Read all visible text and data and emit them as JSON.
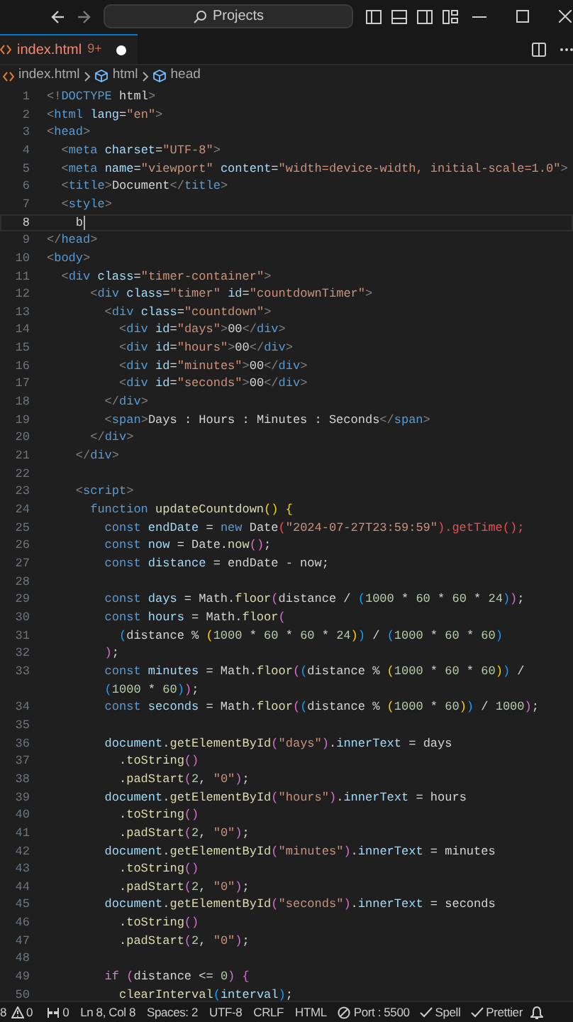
{
  "titlebar": {
    "search": "Projects"
  },
  "tabs": [
    {
      "label": "index.html",
      "badge": "9+",
      "modified": true,
      "selected": true
    }
  ],
  "breadcrumbs": [
    {
      "kind": "file",
      "label": "index.html"
    },
    {
      "kind": "element",
      "label": "html"
    },
    {
      "kind": "element",
      "label": "head"
    }
  ],
  "lines": [
    {
      "n": "1",
      "active": false,
      "tokens": [
        {
          "kind": "p",
          "text": "<!"
        },
        {
          "kind": "tag",
          "text": "DOCTYPE"
        },
        {
          "kind": "t",
          "text": " html"
        },
        {
          "kind": "p",
          "text": ">"
        }
      ]
    },
    {
      "n": "2",
      "active": false,
      "tokens": [
        {
          "kind": "p",
          "text": "<"
        },
        {
          "kind": "tag",
          "text": "html"
        },
        {
          "kind": "at",
          "text": " lang"
        },
        {
          "kind": "t",
          "text": "="
        },
        {
          "kind": "s",
          "text": "\"en\""
        },
        {
          "kind": "p",
          "text": ">"
        }
      ]
    },
    {
      "n": "3",
      "active": false,
      "tokens": [
        {
          "kind": "p",
          "text": "<"
        },
        {
          "kind": "tag",
          "text": "head"
        },
        {
          "kind": "p",
          "text": ">"
        }
      ]
    },
    {
      "n": "4",
      "active": false,
      "tokens": [
        {
          "kind": "p",
          "text": "  <"
        },
        {
          "kind": "tag",
          "text": "meta"
        },
        {
          "kind": "at",
          "text": " charset"
        },
        {
          "kind": "t",
          "text": "="
        },
        {
          "kind": "s",
          "text": "\"UTF-8\""
        },
        {
          "kind": "p",
          "text": ">"
        }
      ]
    },
    {
      "n": "5",
      "active": false,
      "tokens": [
        {
          "kind": "p",
          "text": "  <"
        },
        {
          "kind": "tag",
          "text": "meta"
        },
        {
          "kind": "at",
          "text": " name"
        },
        {
          "kind": "t",
          "text": "="
        },
        {
          "kind": "s",
          "text": "\"viewport\""
        },
        {
          "kind": "at",
          "text": " content"
        },
        {
          "kind": "t",
          "text": "="
        },
        {
          "kind": "s",
          "text": "\"width=device-width, initial-scale=1.0\""
        },
        {
          "kind": "p",
          "text": ">"
        }
      ]
    },
    {
      "n": "6",
      "active": false,
      "tokens": [
        {
          "kind": "p",
          "text": "  <"
        },
        {
          "kind": "tag",
          "text": "title"
        },
        {
          "kind": "p",
          "text": ">"
        },
        {
          "kind": "t",
          "text": "Document"
        },
        {
          "kind": "p",
          "text": "</"
        },
        {
          "kind": "tag",
          "text": "title"
        },
        {
          "kind": "p",
          "text": ">"
        }
      ]
    },
    {
      "n": "7",
      "active": false,
      "tokens": [
        {
          "kind": "p",
          "text": "  <"
        },
        {
          "kind": "tag",
          "text": "style"
        },
        {
          "kind": "p",
          "text": ">"
        }
      ]
    },
    {
      "n": "8",
      "active": true,
      "tokens": [
        {
          "kind": "t",
          "text": "    b"
        }
      ]
    },
    {
      "n": "9",
      "active": false,
      "tokens": [
        {
          "kind": "p",
          "text": "</"
        },
        {
          "kind": "tag",
          "text": "head"
        },
        {
          "kind": "p",
          "text": ">"
        }
      ]
    },
    {
      "n": "10",
      "active": false,
      "tokens": [
        {
          "kind": "p",
          "text": "<"
        },
        {
          "kind": "tag",
          "text": "body"
        },
        {
          "kind": "p",
          "text": ">"
        }
      ]
    },
    {
      "n": "11",
      "active": false,
      "tokens": [
        {
          "kind": "p",
          "text": "  <"
        },
        {
          "kind": "tag",
          "text": "div"
        },
        {
          "kind": "at",
          "text": " class"
        },
        {
          "kind": "t",
          "text": "="
        },
        {
          "kind": "s",
          "text": "\"timer-container\""
        },
        {
          "kind": "p",
          "text": ">"
        }
      ]
    },
    {
      "n": "12",
      "active": false,
      "tokens": [
        {
          "kind": "p",
          "text": "      <"
        },
        {
          "kind": "tag",
          "text": "div"
        },
        {
          "kind": "at",
          "text": " class"
        },
        {
          "kind": "t",
          "text": "="
        },
        {
          "kind": "s",
          "text": "\"timer\""
        },
        {
          "kind": "at",
          "text": " id"
        },
        {
          "kind": "t",
          "text": "="
        },
        {
          "kind": "s",
          "text": "\"countdownTimer\""
        },
        {
          "kind": "p",
          "text": ">"
        }
      ]
    },
    {
      "n": "13",
      "active": false,
      "tokens": [
        {
          "kind": "p",
          "text": "        <"
        },
        {
          "kind": "tag",
          "text": "div"
        },
        {
          "kind": "at",
          "text": " class"
        },
        {
          "kind": "t",
          "text": "="
        },
        {
          "kind": "s",
          "text": "\"countdown\""
        },
        {
          "kind": "p",
          "text": ">"
        }
      ]
    },
    {
      "n": "14",
      "active": false,
      "tokens": [
        {
          "kind": "p",
          "text": "          <"
        },
        {
          "kind": "tag",
          "text": "div"
        },
        {
          "kind": "at",
          "text": " id"
        },
        {
          "kind": "t",
          "text": "="
        },
        {
          "kind": "s",
          "text": "\"days\""
        },
        {
          "kind": "p",
          "text": ">"
        },
        {
          "kind": "t",
          "text": "00"
        },
        {
          "kind": "p",
          "text": "</"
        },
        {
          "kind": "tag",
          "text": "div"
        },
        {
          "kind": "p",
          "text": ">"
        }
      ]
    },
    {
      "n": "15",
      "active": false,
      "tokens": [
        {
          "kind": "p",
          "text": "          <"
        },
        {
          "kind": "tag",
          "text": "div"
        },
        {
          "kind": "at",
          "text": " id"
        },
        {
          "kind": "t",
          "text": "="
        },
        {
          "kind": "s",
          "text": "\"hours\""
        },
        {
          "kind": "p",
          "text": ">"
        },
        {
          "kind": "t",
          "text": "00"
        },
        {
          "kind": "p",
          "text": "</"
        },
        {
          "kind": "tag",
          "text": "div"
        },
        {
          "kind": "p",
          "text": ">"
        }
      ]
    },
    {
      "n": "16",
      "active": false,
      "tokens": [
        {
          "kind": "p",
          "text": "          <"
        },
        {
          "kind": "tag",
          "text": "div"
        },
        {
          "kind": "at",
          "text": " id"
        },
        {
          "kind": "t",
          "text": "="
        },
        {
          "kind": "s",
          "text": "\"minutes\""
        },
        {
          "kind": "p",
          "text": ">"
        },
        {
          "kind": "t",
          "text": "00"
        },
        {
          "kind": "p",
          "text": "</"
        },
        {
          "kind": "tag",
          "text": "div"
        },
        {
          "kind": "p",
          "text": ">"
        }
      ]
    },
    {
      "n": "17",
      "active": false,
      "tokens": [
        {
          "kind": "p",
          "text": "          <"
        },
        {
          "kind": "tag",
          "text": "div"
        },
        {
          "kind": "at",
          "text": " id"
        },
        {
          "kind": "t",
          "text": "="
        },
        {
          "kind": "s",
          "text": "\"seconds\""
        },
        {
          "kind": "p",
          "text": ">"
        },
        {
          "kind": "t",
          "text": "00"
        },
        {
          "kind": "p",
          "text": "</"
        },
        {
          "kind": "tag",
          "text": "div"
        },
        {
          "kind": "p",
          "text": ">"
        }
      ]
    },
    {
      "n": "18",
      "active": false,
      "tokens": [
        {
          "kind": "p",
          "text": "        </"
        },
        {
          "kind": "tag",
          "text": "div"
        },
        {
          "kind": "p",
          "text": ">"
        }
      ]
    },
    {
      "n": "19",
      "active": false,
      "tokens": [
        {
          "kind": "p",
          "text": "        <"
        },
        {
          "kind": "tag",
          "text": "span"
        },
        {
          "kind": "p",
          "text": ">"
        },
        {
          "kind": "t",
          "text": "Days : Hours : Minutes : Seconds"
        },
        {
          "kind": "p",
          "text": "</"
        },
        {
          "kind": "tag",
          "text": "span"
        },
        {
          "kind": "p",
          "text": ">"
        }
      ]
    },
    {
      "n": "20",
      "active": false,
      "tokens": [
        {
          "kind": "p",
          "text": "      </"
        },
        {
          "kind": "tag",
          "text": "div"
        },
        {
          "kind": "p",
          "text": ">"
        }
      ]
    },
    {
      "n": "21",
      "active": false,
      "tokens": [
        {
          "kind": "p",
          "text": "    </"
        },
        {
          "kind": "tag",
          "text": "div"
        },
        {
          "kind": "p",
          "text": ">"
        }
      ]
    },
    {
      "n": "22",
      "active": false
    },
    {
      "n": "23",
      "active": false,
      "tokens": [
        {
          "kind": "p",
          "text": "    <"
        },
        {
          "kind": "tag",
          "text": "script"
        },
        {
          "kind": "p",
          "text": ">"
        }
      ]
    },
    {
      "n": "24",
      "active": false,
      "tokens": [
        {
          "kind": "kw",
          "text": "      function"
        },
        {
          "kind": "fn",
          "text": " updateCountdown"
        },
        {
          "kind": "b1",
          "text": "()"
        },
        {
          "kind": "b1",
          "text": " {"
        }
      ]
    },
    {
      "n": "25",
      "active": false,
      "tokens": [
        {
          "kind": "kw",
          "text": "        const"
        },
        {
          "kind": "v",
          "text": " endDate"
        },
        {
          "kind": "t",
          "text": " = "
        },
        {
          "kind": "kw",
          "text": "new"
        },
        {
          "kind": "t",
          "text": " Date"
        },
        {
          "kind": "e",
          "text": "("
        },
        {
          "kind": "s",
          "text": "\"2024-07-27T23:59:59\""
        },
        {
          "kind": "e",
          "text": ").getTime();"
        }
      ]
    },
    {
      "n": "26",
      "active": false,
      "tokens": [
        {
          "kind": "kw",
          "text": "        const"
        },
        {
          "kind": "v",
          "text": " now"
        },
        {
          "kind": "t",
          "text": " = Date."
        },
        {
          "kind": "fn",
          "text": "now"
        },
        {
          "kind": "b2",
          "text": "()"
        },
        {
          "kind": "t",
          "text": ";"
        }
      ]
    },
    {
      "n": "27",
      "active": false,
      "tokens": [
        {
          "kind": "kw",
          "text": "        const"
        },
        {
          "kind": "v",
          "text": " distance"
        },
        {
          "kind": "t",
          "text": " = endDate - now;"
        }
      ]
    },
    {
      "n": "28",
      "active": false
    },
    {
      "n": "29",
      "active": false,
      "tokens": [
        {
          "kind": "kw",
          "text": "        const"
        },
        {
          "kind": "v",
          "text": " days"
        },
        {
          "kind": "t",
          "text": " = Math."
        },
        {
          "kind": "fn",
          "text": "floor"
        },
        {
          "kind": "b2",
          "text": "("
        },
        {
          "kind": "t",
          "text": "distance / "
        },
        {
          "kind": "b3",
          "text": "("
        },
        {
          "kind": "n",
          "text": "1000"
        },
        {
          "kind": "t",
          "text": " * "
        },
        {
          "kind": "n",
          "text": "60"
        },
        {
          "kind": "t",
          "text": " * "
        },
        {
          "kind": "n",
          "text": "60"
        },
        {
          "kind": "t",
          "text": " * "
        },
        {
          "kind": "n",
          "text": "24"
        },
        {
          "kind": "b3",
          "text": ")"
        },
        {
          "kind": "b2",
          "text": ")"
        },
        {
          "kind": "t",
          "text": ";"
        }
      ]
    },
    {
      "n": "30",
      "active": false,
      "tokens": [
        {
          "kind": "kw",
          "text": "        const"
        },
        {
          "kind": "v",
          "text": " hours"
        },
        {
          "kind": "t",
          "text": " = Math."
        },
        {
          "kind": "fn",
          "text": "floor"
        },
        {
          "kind": "b2",
          "text": "("
        }
      ]
    },
    {
      "n": "31",
      "active": false,
      "tokens": [
        {
          "kind": "b3",
          "text": "          ("
        },
        {
          "kind": "t",
          "text": "distance % "
        },
        {
          "kind": "b1",
          "text": "("
        },
        {
          "kind": "n",
          "text": "1000"
        },
        {
          "kind": "t",
          "text": " * "
        },
        {
          "kind": "n",
          "text": "60"
        },
        {
          "kind": "t",
          "text": " * "
        },
        {
          "kind": "n",
          "text": "60"
        },
        {
          "kind": "t",
          "text": " * "
        },
        {
          "kind": "n",
          "text": "24"
        },
        {
          "kind": "b1",
          "text": ")"
        },
        {
          "kind": "b3",
          "text": ")"
        },
        {
          "kind": "t",
          "text": " / "
        },
        {
          "kind": "b3",
          "text": "("
        },
        {
          "kind": "n",
          "text": "1000"
        },
        {
          "kind": "t",
          "text": " * "
        },
        {
          "kind": "n",
          "text": "60"
        },
        {
          "kind": "t",
          "text": " * "
        },
        {
          "kind": "n",
          "text": "60"
        },
        {
          "kind": "b3",
          "text": ")"
        }
      ]
    },
    {
      "n": "32",
      "active": false,
      "tokens": [
        {
          "kind": "b2",
          "text": "        )"
        },
        {
          "kind": "t",
          "text": ";"
        }
      ]
    },
    {
      "n": "33",
      "active": false,
      "tokens": [
        {
          "kind": "kw",
          "text": "        const"
        },
        {
          "kind": "v",
          "text": " minutes"
        },
        {
          "kind": "t",
          "text": " = Math."
        },
        {
          "kind": "fn",
          "text": "floor"
        },
        {
          "kind": "b2",
          "text": "("
        },
        {
          "kind": "b3",
          "text": "("
        },
        {
          "kind": "t",
          "text": "distance % "
        },
        {
          "kind": "b1",
          "text": "("
        },
        {
          "kind": "n",
          "text": "1000"
        },
        {
          "kind": "t",
          "text": " * "
        },
        {
          "kind": "n",
          "text": "60"
        },
        {
          "kind": "t",
          "text": " * "
        },
        {
          "kind": "n",
          "text": "60"
        },
        {
          "kind": "b1",
          "text": ")"
        },
        {
          "kind": "b3",
          "text": ")"
        },
        {
          "kind": "t",
          "text": " /"
        }
      ]
    },
    {
      "active": false,
      "tokens": [
        {
          "kind": "b3",
          "text": "        ("
        },
        {
          "kind": "n",
          "text": "1000"
        },
        {
          "kind": "t",
          "text": " * "
        },
        {
          "kind": "n",
          "text": "60"
        },
        {
          "kind": "b3",
          "text": ")"
        },
        {
          "kind": "b2",
          "text": ")"
        },
        {
          "kind": "t",
          "text": ";"
        }
      ]
    },
    {
      "n": "34",
      "active": false,
      "tokens": [
        {
          "kind": "kw",
          "text": "        const"
        },
        {
          "kind": "v",
          "text": " seconds"
        },
        {
          "kind": "t",
          "text": " = Math."
        },
        {
          "kind": "fn",
          "text": "floor"
        },
        {
          "kind": "b2",
          "text": "("
        },
        {
          "kind": "b3",
          "text": "("
        },
        {
          "kind": "t",
          "text": "distance % "
        },
        {
          "kind": "b1",
          "text": "("
        },
        {
          "kind": "n",
          "text": "1000"
        },
        {
          "kind": "t",
          "text": " * "
        },
        {
          "kind": "n",
          "text": "60"
        },
        {
          "kind": "b1",
          "text": ")"
        },
        {
          "kind": "b3",
          "text": ")"
        },
        {
          "kind": "t",
          "text": " / "
        },
        {
          "kind": "n",
          "text": "1000"
        },
        {
          "kind": "b2",
          "text": ")"
        },
        {
          "kind": "t",
          "text": ";"
        }
      ]
    },
    {
      "n": "35",
      "active": false
    },
    {
      "n": "36",
      "active": false,
      "tokens": [
        {
          "kind": "v",
          "text": "        document"
        },
        {
          "kind": "t",
          "text": "."
        },
        {
          "kind": "fn",
          "text": "getElementById"
        },
        {
          "kind": "b2",
          "text": "("
        },
        {
          "kind": "s",
          "text": "\"days\""
        },
        {
          "kind": "b2",
          "text": ")"
        },
        {
          "kind": "t",
          "text": "."
        },
        {
          "kind": "v",
          "text": "innerText"
        },
        {
          "kind": "t",
          "text": " = days"
        }
      ]
    },
    {
      "n": "37",
      "active": false,
      "tokens": [
        {
          "kind": "t",
          "text": "          ."
        },
        {
          "kind": "fn",
          "text": "toString"
        },
        {
          "kind": "b2",
          "text": "()"
        }
      ]
    },
    {
      "n": "38",
      "active": false,
      "tokens": [
        {
          "kind": "t",
          "text": "          ."
        },
        {
          "kind": "fn",
          "text": "padStart"
        },
        {
          "kind": "b2",
          "text": "("
        },
        {
          "kind": "n",
          "text": "2"
        },
        {
          "kind": "t",
          "text": ", "
        },
        {
          "kind": "s",
          "text": "\"0\""
        },
        {
          "kind": "b2",
          "text": ")"
        },
        {
          "kind": "t",
          "text": ";"
        }
      ]
    },
    {
      "n": "39",
      "active": false,
      "tokens": [
        {
          "kind": "v",
          "text": "        document"
        },
        {
          "kind": "t",
          "text": "."
        },
        {
          "kind": "fn",
          "text": "getElementById"
        },
        {
          "kind": "b2",
          "text": "("
        },
        {
          "kind": "s",
          "text": "\"hours\""
        },
        {
          "kind": "b2",
          "text": ")"
        },
        {
          "kind": "t",
          "text": "."
        },
        {
          "kind": "v",
          "text": "innerText"
        },
        {
          "kind": "t",
          "text": " = hours"
        }
      ]
    },
    {
      "n": "40",
      "active": false,
      "tokens": [
        {
          "kind": "t",
          "text": "          ."
        },
        {
          "kind": "fn",
          "text": "toString"
        },
        {
          "kind": "b2",
          "text": "()"
        }
      ]
    },
    {
      "n": "41",
      "active": false,
      "tokens": [
        {
          "kind": "t",
          "text": "          ."
        },
        {
          "kind": "fn",
          "text": "padStart"
        },
        {
          "kind": "b2",
          "text": "("
        },
        {
          "kind": "n",
          "text": "2"
        },
        {
          "kind": "t",
          "text": ", "
        },
        {
          "kind": "s",
          "text": "\"0\""
        },
        {
          "kind": "b2",
          "text": ")"
        },
        {
          "kind": "t",
          "text": ";"
        }
      ]
    },
    {
      "n": "42",
      "active": false,
      "tokens": [
        {
          "kind": "v",
          "text": "        document"
        },
        {
          "kind": "t",
          "text": "."
        },
        {
          "kind": "fn",
          "text": "getElementById"
        },
        {
          "kind": "b2",
          "text": "("
        },
        {
          "kind": "s",
          "text": "\"minutes\""
        },
        {
          "kind": "b2",
          "text": ")"
        },
        {
          "kind": "t",
          "text": "."
        },
        {
          "kind": "v",
          "text": "innerText"
        },
        {
          "kind": "t",
          "text": " = minutes"
        }
      ]
    },
    {
      "n": "43",
      "active": false,
      "tokens": [
        {
          "kind": "t",
          "text": "          ."
        },
        {
          "kind": "fn",
          "text": "toString"
        },
        {
          "kind": "b2",
          "text": "()"
        }
      ]
    },
    {
      "n": "44",
      "active": false,
      "tokens": [
        {
          "kind": "t",
          "text": "          ."
        },
        {
          "kind": "fn",
          "text": "padStart"
        },
        {
          "kind": "b2",
          "text": "("
        },
        {
          "kind": "n",
          "text": "2"
        },
        {
          "kind": "t",
          "text": ", "
        },
        {
          "kind": "s",
          "text": "\"0\""
        },
        {
          "kind": "b2",
          "text": ")"
        },
        {
          "kind": "t",
          "text": ";"
        }
      ]
    },
    {
      "n": "45",
      "active": false,
      "tokens": [
        {
          "kind": "v",
          "text": "        document"
        },
        {
          "kind": "t",
          "text": "."
        },
        {
          "kind": "fn",
          "text": "getElementById"
        },
        {
          "kind": "b2",
          "text": "("
        },
        {
          "kind": "s",
          "text": "\"seconds\""
        },
        {
          "kind": "b2",
          "text": ")"
        },
        {
          "kind": "t",
          "text": "."
        },
        {
          "kind": "v",
          "text": "innerText"
        },
        {
          "kind": "t",
          "text": " = seconds"
        }
      ]
    },
    {
      "n": "46",
      "active": false,
      "tokens": [
        {
          "kind": "t",
          "text": "          ."
        },
        {
          "kind": "fn",
          "text": "toString"
        },
        {
          "kind": "b2",
          "text": "()"
        }
      ]
    },
    {
      "n": "47",
      "active": false,
      "tokens": [
        {
          "kind": "t",
          "text": "          ."
        },
        {
          "kind": "fn",
          "text": "padStart"
        },
        {
          "kind": "b2",
          "text": "("
        },
        {
          "kind": "n",
          "text": "2"
        },
        {
          "kind": "t",
          "text": ", "
        },
        {
          "kind": "s",
          "text": "\"0\""
        },
        {
          "kind": "b2",
          "text": ")"
        },
        {
          "kind": "t",
          "text": ";"
        }
      ]
    },
    {
      "n": "48",
      "active": false
    },
    {
      "n": "49",
      "active": false,
      "tokens": [
        {
          "kind": "c",
          "text": "        if"
        },
        {
          "kind": "b2",
          "text": " ("
        },
        {
          "kind": "t",
          "text": "distance <= "
        },
        {
          "kind": "n",
          "text": "0"
        },
        {
          "kind": "b2",
          "text": ")"
        },
        {
          "kind": "b2",
          "text": " {"
        }
      ]
    },
    {
      "n": "50",
      "active": false,
      "tokens": [
        {
          "kind": "fn",
          "text": "          clearInterval"
        },
        {
          "kind": "b3",
          "text": "("
        },
        {
          "kind": "v",
          "text": "interval"
        },
        {
          "kind": "b3",
          "text": ")"
        },
        {
          "kind": "t",
          "text": ";"
        }
      ]
    }
  ],
  "status_bar": [
    {
      "kind": "errors",
      "text": "8"
    },
    {
      "kind": "warnings",
      "text": "0"
    },
    {
      "kind": "ports",
      "text": "0"
    },
    {
      "kind": "plain",
      "text": "Ln 8, Col 8"
    },
    {
      "kind": "plain",
      "text": "Spaces: 2"
    },
    {
      "kind": "plain",
      "text": "UTF-8"
    },
    {
      "kind": "plain",
      "text": "CRLF"
    },
    {
      "kind": "plain",
      "text": "HTML"
    },
    {
      "kind": "port",
      "text": "Port : 5500"
    },
    {
      "kind": "check",
      "text": "Spell"
    },
    {
      "kind": "check",
      "text": "Prettier"
    },
    {
      "kind": "bell"
    }
  ]
}
